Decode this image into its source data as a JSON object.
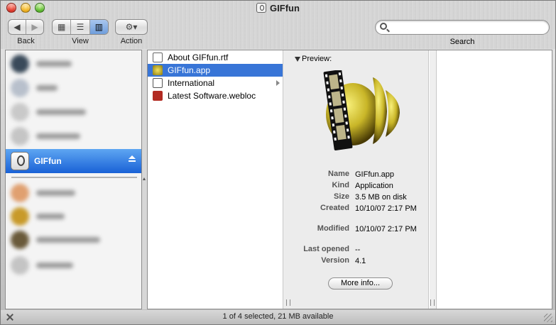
{
  "window": {
    "title": "GIFfun"
  },
  "toolbar": {
    "back_label": "Back",
    "view_label": "View",
    "action_label": "Action",
    "search_label": "Search",
    "search_value": "",
    "search_placeholder": "",
    "view_modes": [
      "icon",
      "list",
      "column"
    ],
    "selected_view": "column"
  },
  "sidebar": {
    "selected_item": {
      "label": "GIFfun",
      "icon": "disk-image-icon"
    }
  },
  "column1": {
    "items": [
      {
        "name": "About GIFfun.rtf",
        "icon": "rtf-document-icon",
        "selected": false,
        "has_children": false
      },
      {
        "name": "GIFfun.app",
        "icon": "app-icon",
        "selected": true,
        "has_children": false
      },
      {
        "name": "International",
        "icon": "folder-globe-icon",
        "selected": false,
        "has_children": true
      },
      {
        "name": "Latest Software.webloc",
        "icon": "webloc-icon",
        "selected": false,
        "has_children": false
      }
    ]
  },
  "preview": {
    "title": "Preview:",
    "info": [
      {
        "key": "Name",
        "value": "GIFfun.app"
      },
      {
        "key": "Kind",
        "value": "Application"
      },
      {
        "key": "Size",
        "value": "3.5 MB on disk"
      },
      {
        "key": "Created",
        "value": "10/10/07 2:17 PM"
      },
      {
        "key": "Modified",
        "value": "10/10/07 2:17 PM"
      },
      {
        "key": "Last opened",
        "value": "--"
      },
      {
        "key": "Version",
        "value": "4.1"
      }
    ],
    "more_info_label": "More info..."
  },
  "status": {
    "text": "1 of 4 selected, 21 MB available"
  },
  "colors": {
    "selection": "#3875d7",
    "sidebar_selection": "#1961d6"
  }
}
